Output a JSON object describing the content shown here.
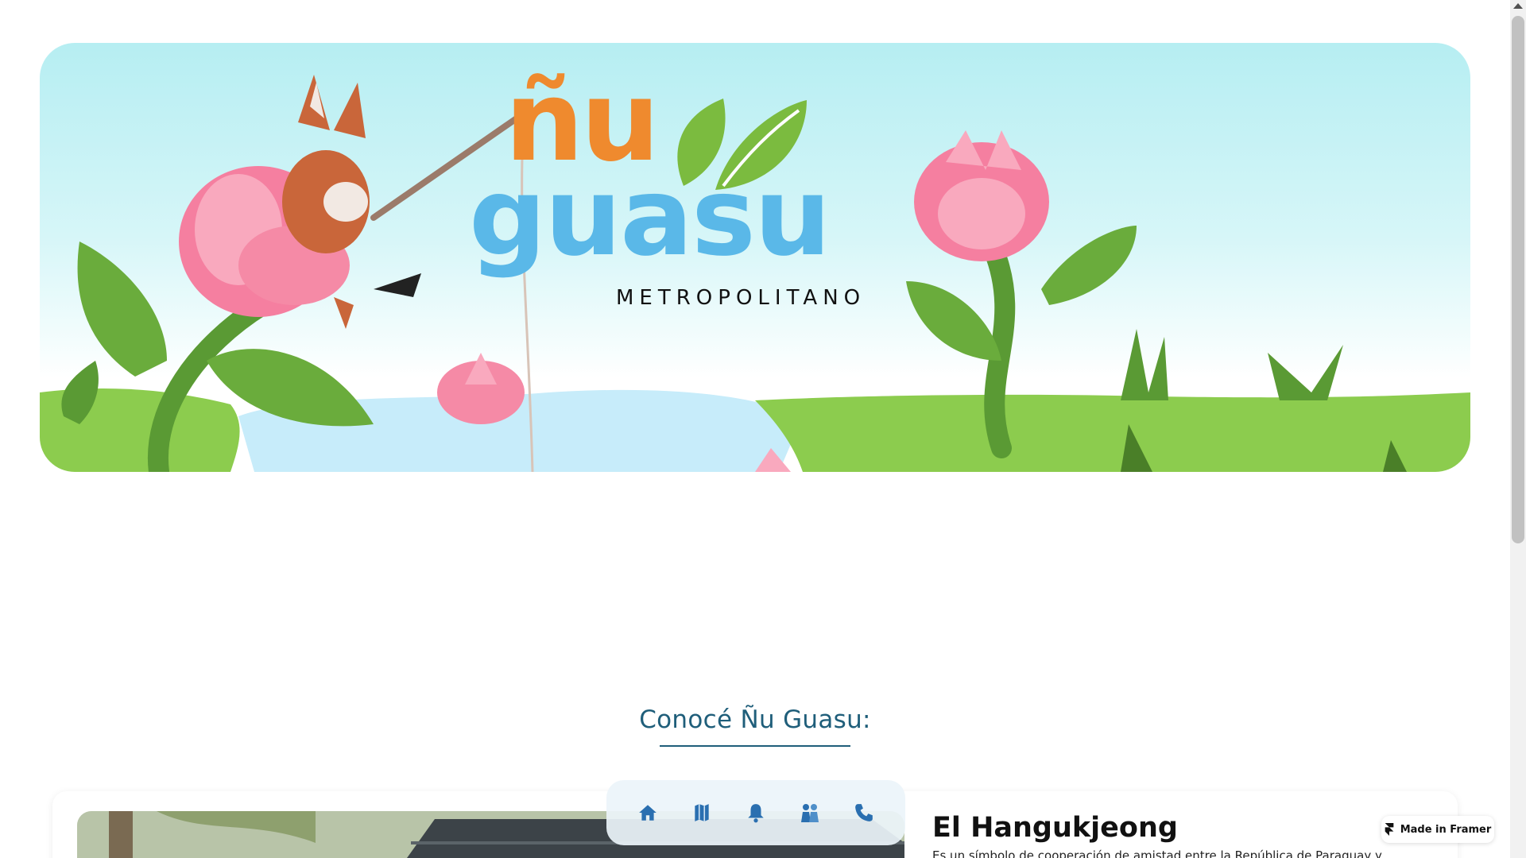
{
  "hero": {
    "logo_line1": "ñu",
    "logo_line2": "guasu",
    "logo_subtitle": "METROPOLITANO"
  },
  "section": {
    "title": "Conocé Ñu Guasu:"
  },
  "card": {
    "title": "El Hangukjeong",
    "description": "Es un símbolo de cooperación de amistad entre la República de Paraguay y"
  },
  "nav": {
    "items": [
      {
        "icon": "home-icon",
        "color": "#2a6fb0"
      },
      {
        "icon": "map-icon",
        "color": "#2a6fb0"
      },
      {
        "icon": "bell-icon",
        "color": "#2a6fb0"
      },
      {
        "icon": "people-icon",
        "color": "#2a6fb0"
      },
      {
        "icon": "phone-icon",
        "color": "#2a6fb0"
      }
    ]
  },
  "badge": {
    "label": "Made in Framer"
  },
  "colors": {
    "logo_orange": "#ef8a2e",
    "logo_blue": "#5ab8e8",
    "leaf_green": "#7bbb3f",
    "heading_teal": "#1f5e7a",
    "flower_pink": "#f58aa6"
  }
}
